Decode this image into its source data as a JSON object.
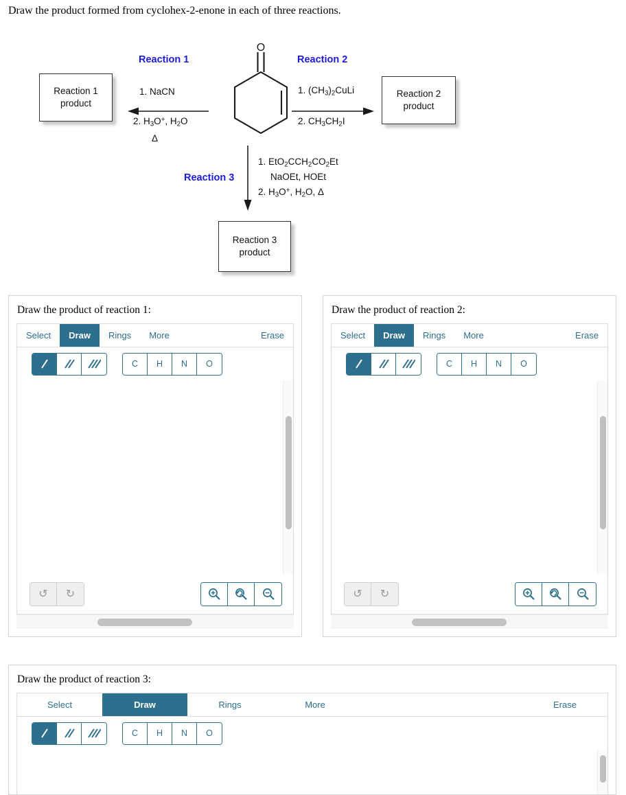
{
  "question": {
    "text": "Draw the product formed from cyclohex-2-enone in each of three reactions."
  },
  "scheme": {
    "labels": {
      "reaction1": "Reaction 1",
      "reaction2": "Reaction 2",
      "reaction3": "Reaction 3"
    },
    "boxes": {
      "product1_line1": "Reaction 1",
      "product1_line2": "product",
      "product2_line1": "Reaction 2",
      "product2_line2": "product",
      "product3_line1": "Reaction 3",
      "product3_line2": "product"
    },
    "reagents": {
      "r1_step1": "1. NaCN",
      "r1_step2": "2. H3O+, H2O",
      "r1_step3": "Δ",
      "r2_step1": "1. (CH3)2CuLi",
      "r2_step2": "2. CH3CH2I",
      "r3_step1": "1. EtO2CCH2CO2Et",
      "r3_step1b": "NaOEt, HOEt",
      "r3_step2": "2. H3O+, H2O, Δ"
    },
    "substrate_name": "cyclohex-2-enone",
    "substrate_oxygen_label": "O"
  },
  "editor_toolbar": {
    "tabs": [
      {
        "label": "Select",
        "active": false
      },
      {
        "label": "Draw",
        "active": true
      },
      {
        "label": "Rings",
        "active": false
      },
      {
        "label": "More",
        "active": false
      }
    ],
    "erase_label": "Erase",
    "bond_buttons": [
      {
        "name": "single-bond",
        "selected": true
      },
      {
        "name": "double-bond",
        "selected": false
      },
      {
        "name": "triple-bond",
        "selected": false
      }
    ],
    "element_buttons": [
      "C",
      "H",
      "N",
      "O"
    ],
    "history_buttons": [
      {
        "name": "undo",
        "glyph": "↺",
        "disabled": true
      },
      {
        "name": "redo",
        "glyph": "↻",
        "disabled": true
      }
    ],
    "zoom_buttons": [
      {
        "name": "zoom-in"
      },
      {
        "name": "zoom-reset"
      },
      {
        "name": "zoom-out"
      }
    ]
  },
  "panels": [
    {
      "title": "Draw the product of reaction 1:"
    },
    {
      "title": "Draw the product of reaction 2:"
    },
    {
      "title": "Draw the product of reaction 3:"
    }
  ],
  "colors": {
    "accent_teal": "#2e6f8e",
    "label_blue": "#1b1bdc",
    "panel_border": "#d3d3d3",
    "scrollbar_thumb": "#bfbfbf"
  }
}
